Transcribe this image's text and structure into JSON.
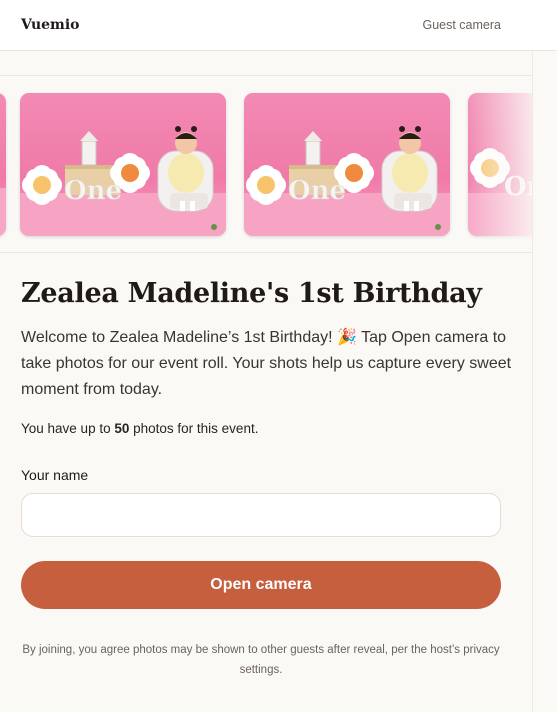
{
  "header": {
    "brand": "Vuemio",
    "mode_label": "Guest camera"
  },
  "gallery": {
    "photos": [
      {
        "alt": "Baby sitting on white chair with pink background and 'One' sign"
      },
      {
        "alt": "Baby sitting on white chair with pink background and 'One' sign"
      },
      {
        "alt": "Baby sitting on white chair with pink background and 'One' sign"
      }
    ],
    "sign_text": "One"
  },
  "event": {
    "title": "Zealea Madeline's 1st Birthday",
    "intro": "Welcome to Zealea Madeline’s 1st Birthday! 🎉  Tap Open camera to take photos for our event roll. Your shots help us capture every sweet moment from today.",
    "limit_prefix": "You have up to ",
    "limit_count": "50",
    "limit_suffix": " photos for this event."
  },
  "form": {
    "name_label": "Your name",
    "name_value": "",
    "name_placeholder": "",
    "open_button": "Open camera"
  },
  "footer": {
    "note": "By joining, you agree photos may be shown to other guests after reveal, per the host’s privacy settings."
  },
  "colors": {
    "accent": "#c55f3e",
    "background": "#fbf9f6",
    "photo_pink": "#f28ab4"
  }
}
